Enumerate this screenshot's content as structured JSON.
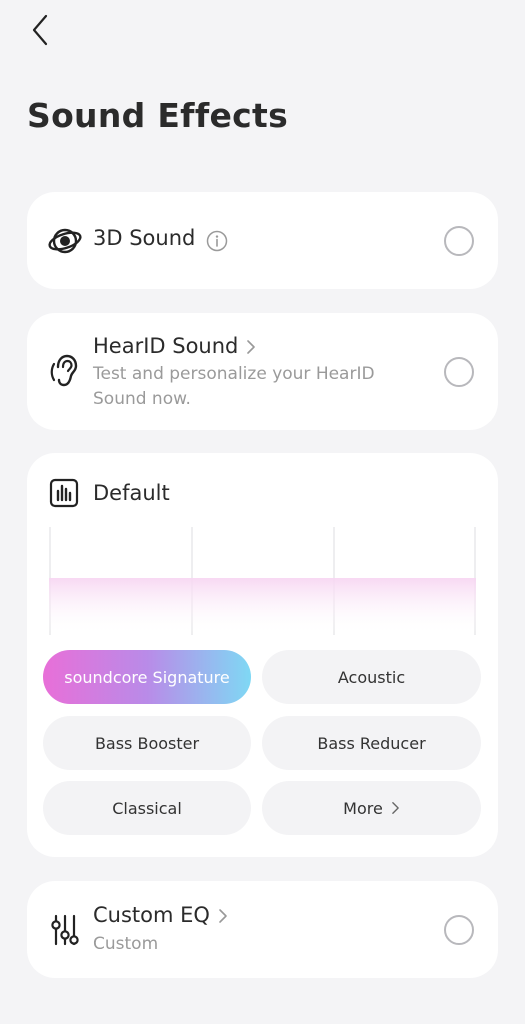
{
  "header": {
    "back_icon": "chevron-left-icon",
    "title": "Sound Effects"
  },
  "effects": {
    "sound3d": {
      "title": "3D Sound",
      "icon": "orbit-icon",
      "info_icon": "info-icon",
      "selected": false
    },
    "hearid": {
      "title": "HearID Sound",
      "subtitle_line1": "Test and personalize your HearID",
      "subtitle_line2": "Sound now.",
      "icon": "ear-icon",
      "selected": false
    },
    "eq_preset": {
      "title": "Default",
      "icon": "equalizer-icon"
    },
    "custom_eq": {
      "title": "Custom EQ",
      "subtitle": "Custom",
      "icon": "sliders-icon",
      "selected": false
    }
  },
  "presets": {
    "items": [
      {
        "label": "soundcore Signature",
        "active": true
      },
      {
        "label": "Acoustic",
        "active": false
      },
      {
        "label": "Bass Booster",
        "active": false
      },
      {
        "label": "Bass Reducer",
        "active": false
      },
      {
        "label": "Classical",
        "active": false
      },
      {
        "label": "More",
        "active": false
      }
    ]
  },
  "colors": {
    "background": "#f4f4f6",
    "card": "#ffffff",
    "accent_start": "#e86fd8",
    "accent_end": "#7fd8f4",
    "muted_text": "#9a9a9a"
  }
}
